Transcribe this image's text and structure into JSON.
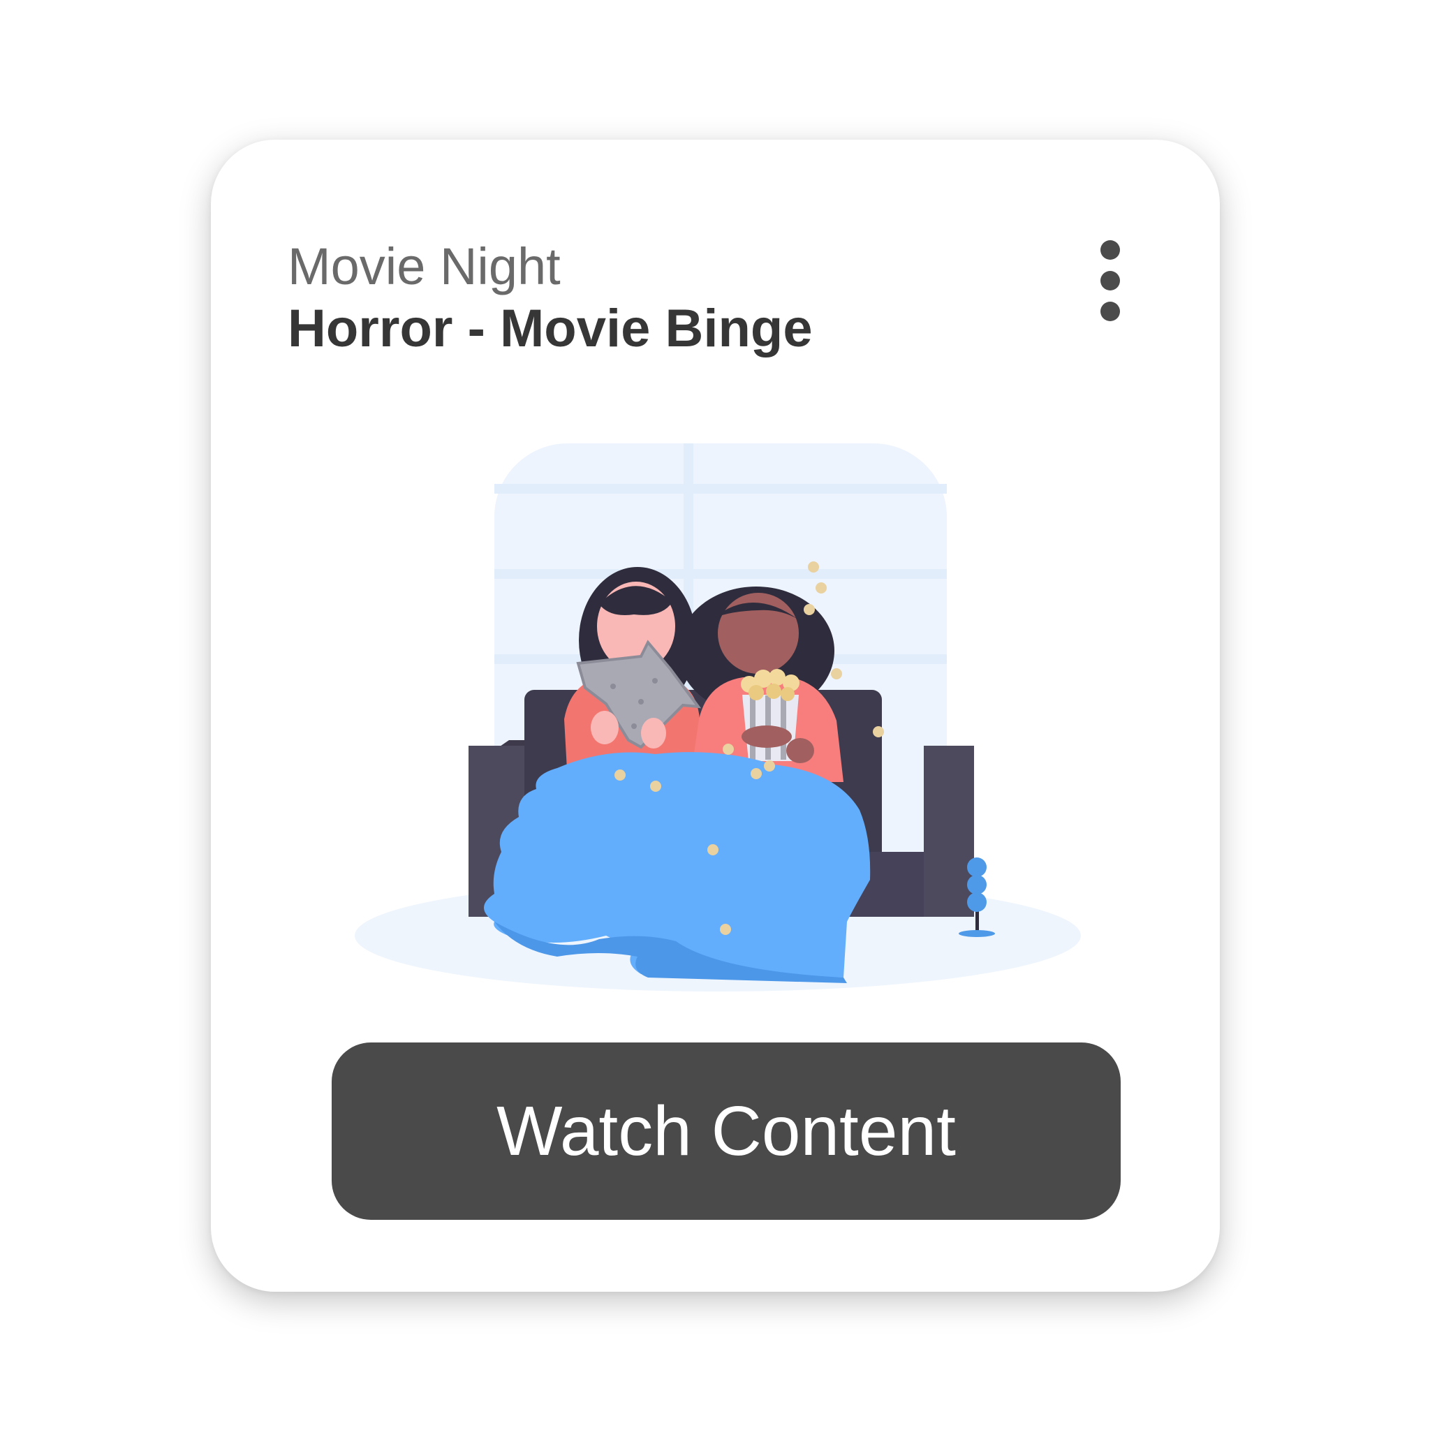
{
  "card": {
    "eyebrow": "Movie Night",
    "title": "Horror - Movie Binge",
    "menu_icon": "more-vertical-icon",
    "illustration": "movie-night-illustration",
    "cta_label": "Watch Content"
  },
  "colors": {
    "card_background": "#ffffff",
    "eyebrow_text": "#6a6a6a",
    "title_text": "#363636",
    "button_background": "#4a4a4a",
    "button_text": "#ffffff",
    "blanket": "#62aefd",
    "sofa": "#4e4a5e",
    "window": "#edf4fd"
  }
}
